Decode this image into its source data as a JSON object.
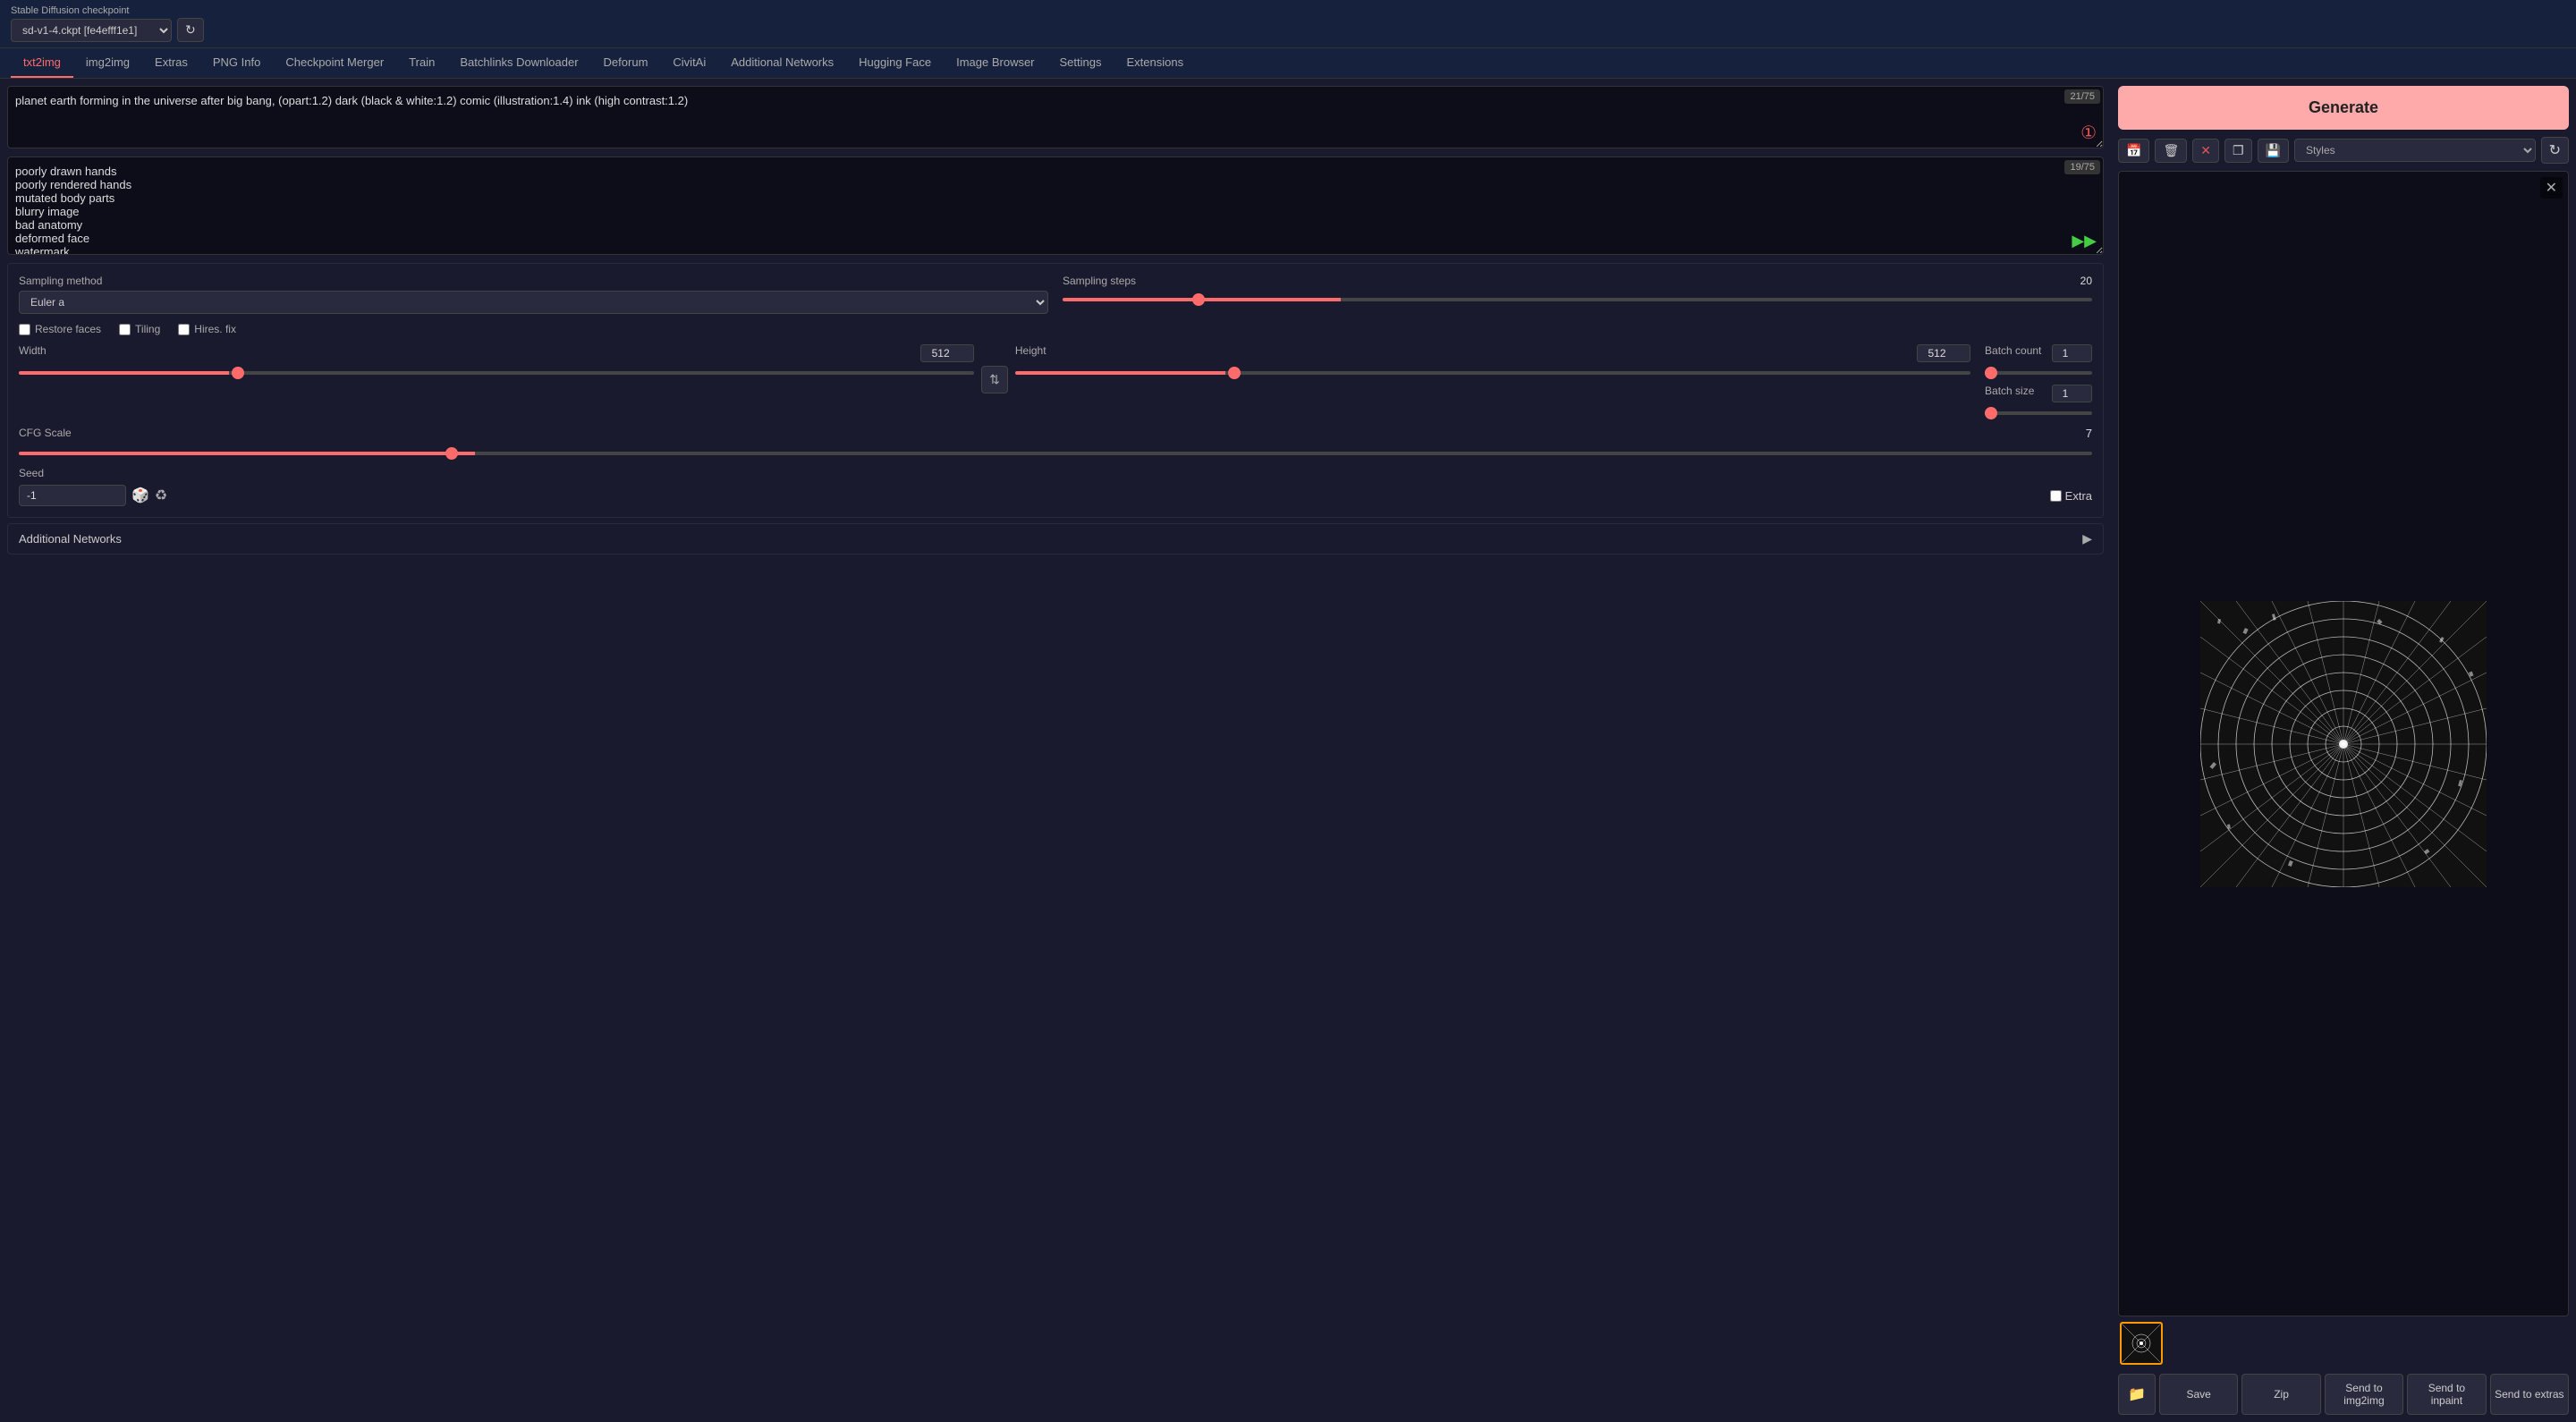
{
  "topbar": {
    "checkpoint_label": "Stable Diffusion checkpoint",
    "checkpoint_value": "sd-v1-4.ckpt [fe4efff1e1]",
    "refresh_icon": "↻"
  },
  "nav": {
    "tabs": [
      {
        "id": "txt2img",
        "label": "txt2img",
        "active": true
      },
      {
        "id": "img2img",
        "label": "img2img",
        "active": false
      },
      {
        "id": "extras",
        "label": "Extras",
        "active": false
      },
      {
        "id": "pnginfo",
        "label": "PNG Info",
        "active": false
      },
      {
        "id": "checkpoint_merger",
        "label": "Checkpoint Merger",
        "active": false
      },
      {
        "id": "train",
        "label": "Train",
        "active": false
      },
      {
        "id": "batchlinks",
        "label": "Batchlinks Downloader",
        "active": false
      },
      {
        "id": "deforum",
        "label": "Deforum",
        "active": false
      },
      {
        "id": "civitai",
        "label": "CivitAi",
        "active": false
      },
      {
        "id": "additional_networks",
        "label": "Additional Networks",
        "active": false
      },
      {
        "id": "hugging_face",
        "label": "Hugging Face",
        "active": false
      },
      {
        "id": "image_browser",
        "label": "Image Browser",
        "active": false
      },
      {
        "id": "settings",
        "label": "Settings",
        "active": false
      },
      {
        "id": "extensions",
        "label": "Extensions",
        "active": false
      }
    ]
  },
  "prompt": {
    "positive_text": "planet earth forming in the universe after big bang, (opart:1.2) dark (black & white:1.2) comic (illustration:1.4) ink (high contrast:1.2)",
    "positive_token_count": "21/75",
    "negative_text": "poorly drawn hands\npoorly rendered hands\nmutated body parts\nblurry image\nbad anatomy\ndeformed face\nwatermark",
    "negative_token_count": "19/75"
  },
  "sampling": {
    "method_label": "Sampling method",
    "method_value": "Euler a",
    "steps_label": "Sampling steps",
    "steps_value": 20,
    "steps_min": 1,
    "steps_max": 150
  },
  "checkboxes": {
    "restore_faces": {
      "label": "Restore faces",
      "checked": false
    },
    "tiling": {
      "label": "Tiling",
      "checked": false
    },
    "hires_fix": {
      "label": "Hires. fix",
      "checked": false
    }
  },
  "dimensions": {
    "width_label": "Width",
    "width_value": 512,
    "height_label": "Height",
    "height_value": 512,
    "swap_icon": "⇅"
  },
  "batch": {
    "count_label": "Batch count",
    "count_value": 1,
    "size_label": "Batch size",
    "size_value": 1
  },
  "cfg": {
    "label": "CFG Scale",
    "value": 7,
    "min": 1,
    "max": 30
  },
  "seed": {
    "label": "Seed",
    "value": "-1",
    "extra_label": "Extra",
    "dice_icon": "🎲",
    "recycle_icon": "♻"
  },
  "additional_networks": {
    "label": "Additional Networks",
    "collapse_icon": "▶"
  },
  "generate": {
    "label": "Generate"
  },
  "styles": {
    "label": "Styles",
    "placeholder": "Styles"
  },
  "image_actions": {
    "open_folder_icon": "📁",
    "trash_icon": "🗑",
    "cross_icon": "✕",
    "copy_icon": "❐",
    "save_icon": "💾"
  },
  "bottom_actions": {
    "folder_icon": "📁",
    "save_label": "Save",
    "zip_label": "Zip",
    "send_to_img2img_label": "Send to\nimg2img",
    "send_to_inpaint_label": "Send to inpaint",
    "send_to_extras_label": "Send to extras"
  }
}
